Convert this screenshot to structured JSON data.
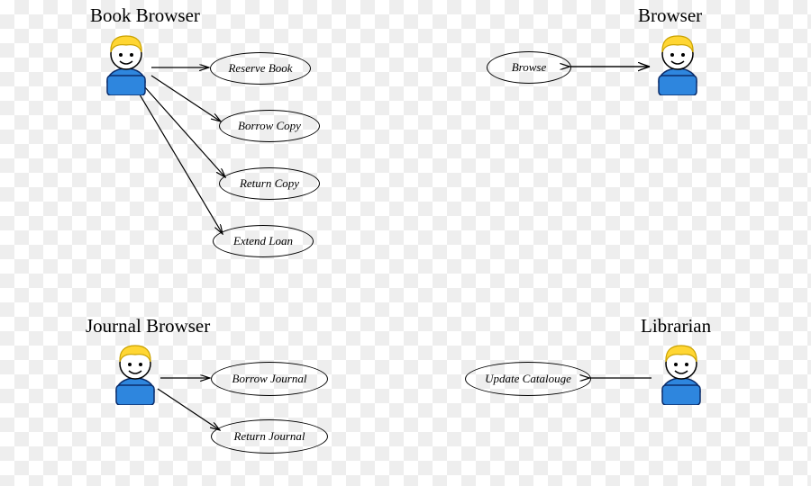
{
  "actors": {
    "book_browser": {
      "label": "Book Browser"
    },
    "browser": {
      "label": "Browser"
    },
    "journal_browser": {
      "label": "Journal Browser"
    },
    "librarian": {
      "label": "Librarian"
    }
  },
  "usecases": {
    "reserve_book": "Reserve Book",
    "borrow_copy": "Borrow Copy",
    "return_copy": "Return Copy",
    "extend_loan": "Extend Loan",
    "browse": "Browse",
    "borrow_journal": "Borrow Journal",
    "return_journal": "Return Journal",
    "update_catalouge": "Update Catalouge"
  },
  "colors": {
    "hair": "#ffd633",
    "hair_stroke": "#c9a100",
    "face": "#ffffff",
    "body": "#2e86de",
    "body_stroke": "#0b2d6b",
    "line": "#000000"
  },
  "associations": [
    {
      "from": "book_browser",
      "to": "reserve_book"
    },
    {
      "from": "book_browser",
      "to": "borrow_copy"
    },
    {
      "from": "book_browser",
      "to": "return_copy"
    },
    {
      "from": "book_browser",
      "to": "extend_loan"
    },
    {
      "from": "browser",
      "to": "browse"
    },
    {
      "from": "journal_browser",
      "to": "borrow_journal"
    },
    {
      "from": "journal_browser",
      "to": "return_journal"
    },
    {
      "from": "librarian",
      "to": "update_catalouge"
    }
  ]
}
